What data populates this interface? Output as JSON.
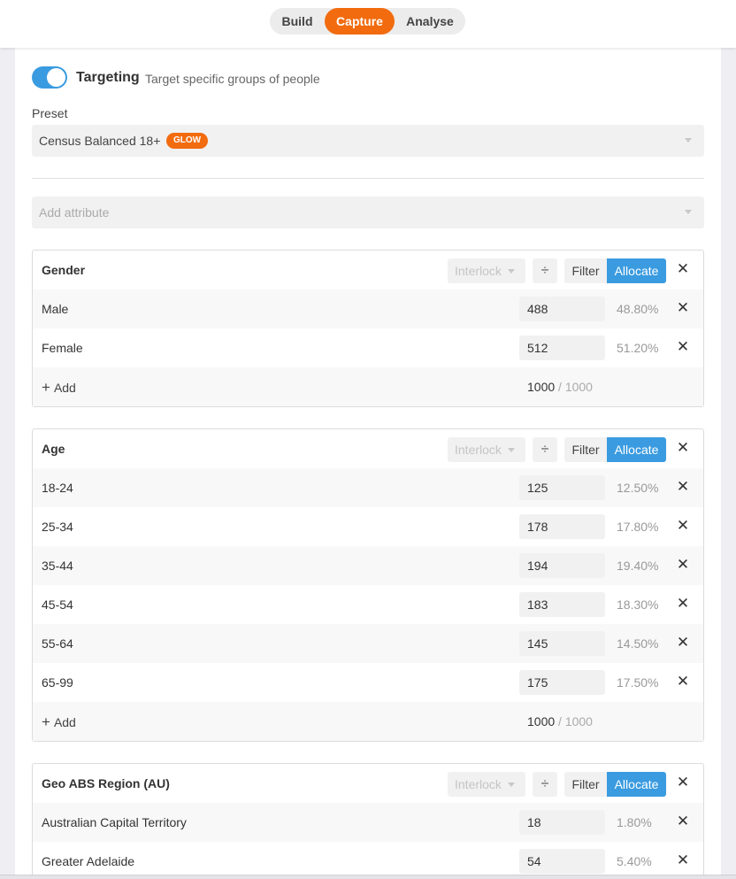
{
  "nav": {
    "tabs": [
      {
        "label": "Build"
      },
      {
        "label": "Capture"
      },
      {
        "label": "Analyse"
      }
    ],
    "active_color": "#f26b0f"
  },
  "targeting": {
    "enabled": true,
    "title": "Targeting",
    "subtitle": "Target specific groups of people"
  },
  "preset": {
    "label": "Preset",
    "value": "Census Balanced 18+",
    "badge": "GLOW"
  },
  "add_attribute": {
    "placeholder": "Add attribute"
  },
  "controls": {
    "interlock": "Interlock",
    "divide_symbol": "÷",
    "filter": "Filter",
    "allocate": "Allocate",
    "remove": "✕",
    "add": "Add",
    "add_symbol": "+"
  },
  "attributes": [
    {
      "title": "Gender",
      "rows": [
        {
          "label": "Male",
          "value": "488",
          "pct": "48.80%"
        },
        {
          "label": "Female",
          "value": "512",
          "pct": "51.20%"
        }
      ],
      "total": "1000",
      "total_max": "/ 1000"
    },
    {
      "title": "Age",
      "rows": [
        {
          "label": "18-24",
          "value": "125",
          "pct": "12.50%"
        },
        {
          "label": "25-34",
          "value": "178",
          "pct": "17.80%"
        },
        {
          "label": "35-44",
          "value": "194",
          "pct": "19.40%"
        },
        {
          "label": "45-54",
          "value": "183",
          "pct": "18.30%"
        },
        {
          "label": "55-64",
          "value": "145",
          "pct": "14.50%"
        },
        {
          "label": "65-99",
          "value": "175",
          "pct": "17.50%"
        }
      ],
      "total": "1000",
      "total_max": "/ 1000"
    },
    {
      "title": "Geo ABS Region (AU)",
      "rows": [
        {
          "label": "Australian Capital Territory",
          "value": "18",
          "pct": "1.80%"
        },
        {
          "label": "Greater Adelaide",
          "value": "54",
          "pct": "5.40%"
        }
      ]
    }
  ],
  "colors": {
    "accent_orange": "#f26b0f",
    "accent_blue": "#3a9be0"
  }
}
